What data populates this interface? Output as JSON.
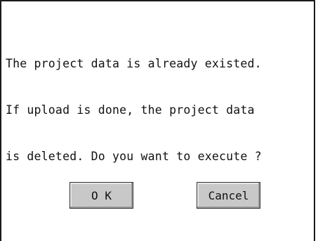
{
  "dialog": {
    "message_lines": [
      "The project data is already existed.",
      "If upload is done, the project data",
      "is deleted. Do you want to execute ?"
    ]
  },
  "buttons": {
    "ok_label": "O K",
    "cancel_label": "Cancel"
  },
  "colors": {
    "background": "#ffffff",
    "button_face": "#c8c8c8",
    "border": "#1a1a1a",
    "text": "#111111"
  }
}
